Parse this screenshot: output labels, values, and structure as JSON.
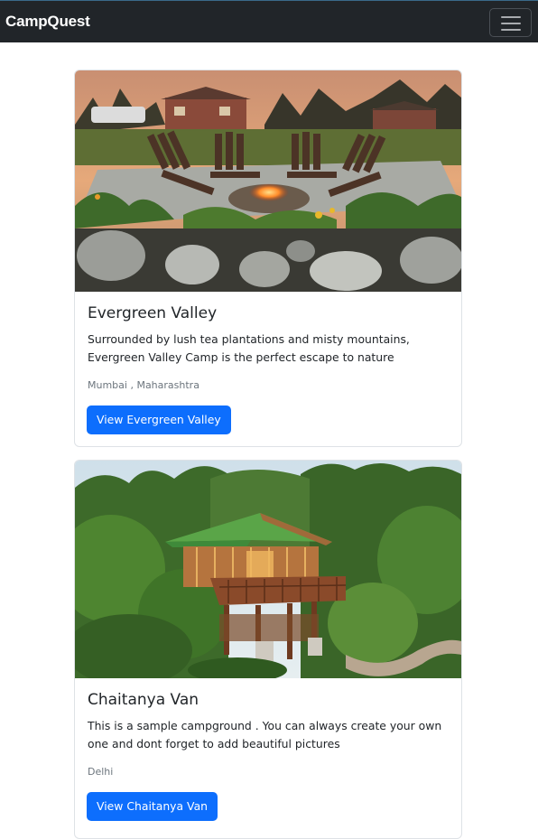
{
  "navbar": {
    "brand": "CampQuest"
  },
  "campgrounds": [
    {
      "title": "Evergreen Valley",
      "description": "Surrounded by lush tea plantations and misty mountains, Evergreen Valley Camp is the perfect escape to nature",
      "location": "Mumbai , Maharashtra",
      "button_label": "View Evergreen Valley"
    },
    {
      "title": "Chaitanya Van",
      "description": "This is a sample campground . You can always create your own one and dont forget to add beautiful pictures",
      "location": "Delhi",
      "button_label": "View Chaitanya Van"
    }
  ],
  "colors": {
    "navbar_bg": "#212529",
    "button_bg": "#0d6efd",
    "muted_text": "#6c757d"
  },
  "icons": {
    "menu": "hamburger-icon"
  }
}
